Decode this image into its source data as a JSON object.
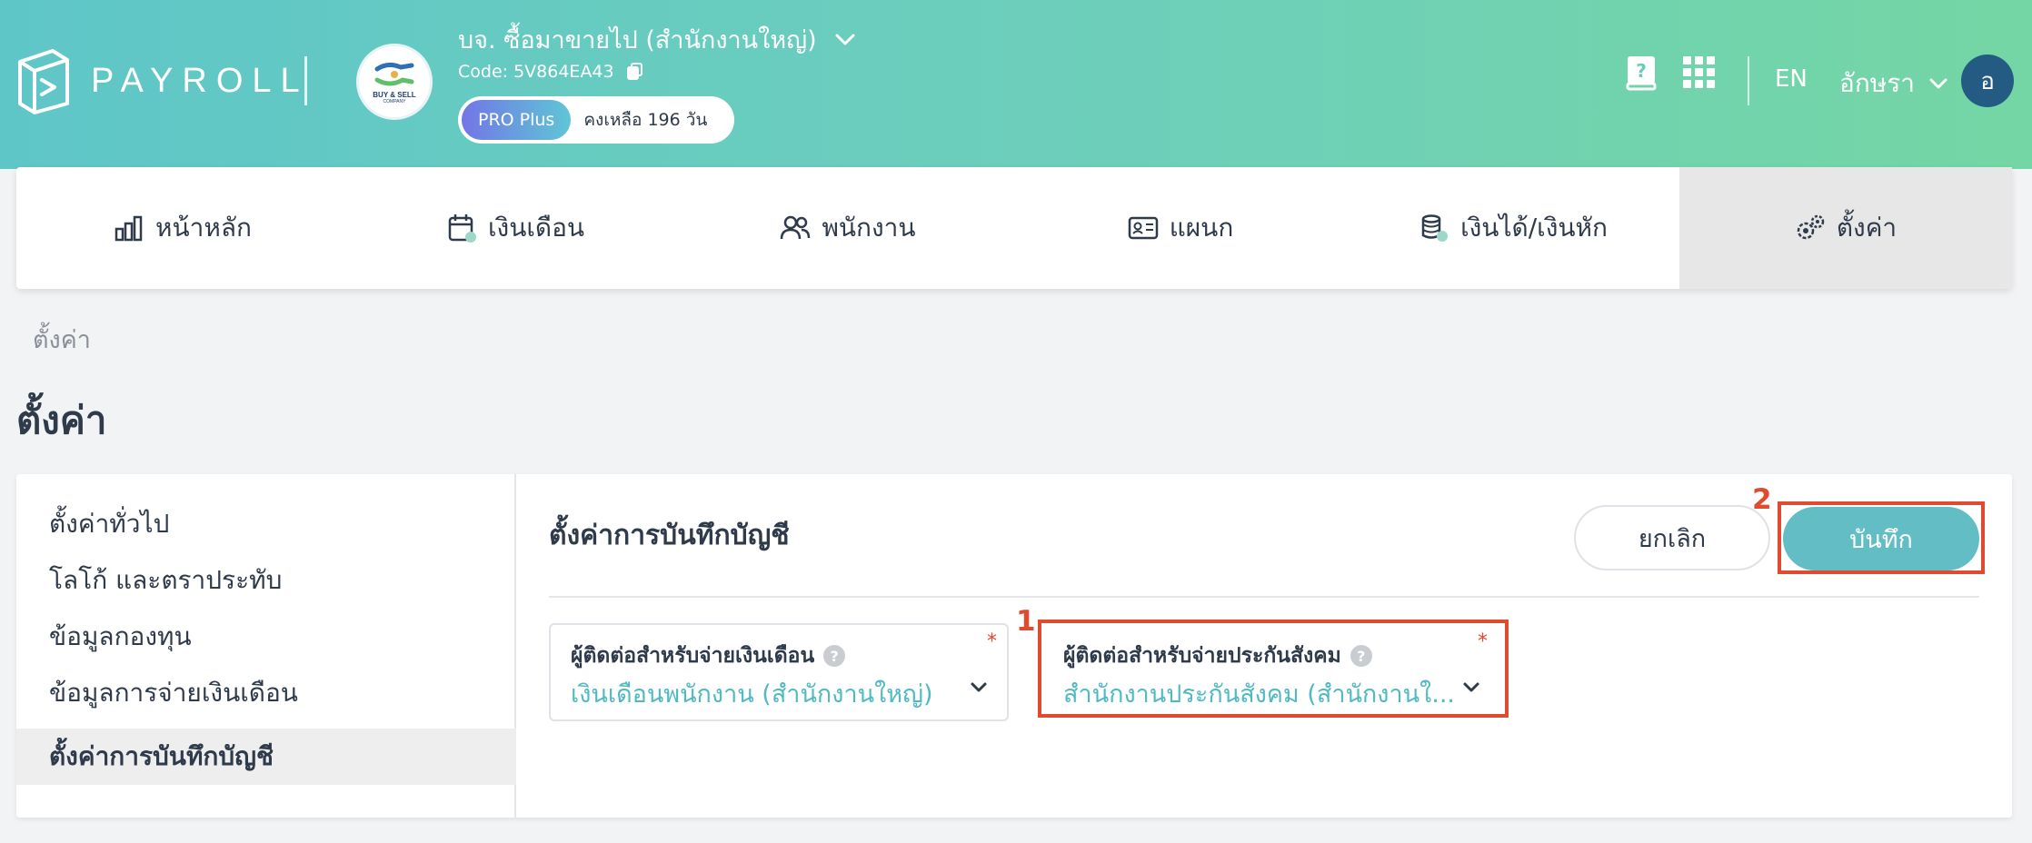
{
  "header": {
    "logo_text": "PAYROLL",
    "company_name": "บจ. ซื้อมาขายไป (สำนักงานใหญ่)",
    "company_logo_caption": "BUY & SELL",
    "company_logo_caption2": "COMPANY",
    "company_code": "Code: 5V864EA43",
    "plan_name": "PRO Plus",
    "plan_remaining": "คงเหลือ 196 วัน",
    "language": "EN",
    "user_name": "อักษรา",
    "user_initial": "อ"
  },
  "nav": {
    "items": [
      {
        "label": "หน้าหลัก",
        "icon": "chart-icon"
      },
      {
        "label": "เงินเดือน",
        "icon": "calendar-icon"
      },
      {
        "label": "พนักงาน",
        "icon": "people-icon"
      },
      {
        "label": "แผนก",
        "icon": "id-card-icon"
      },
      {
        "label": "เงินได้/เงินหัก",
        "icon": "coins-icon"
      },
      {
        "label": "ตั้งค่า",
        "icon": "gears-icon"
      }
    ],
    "active_index": 5
  },
  "breadcrumb": "ตั้งค่า",
  "page_title": "ตั้งค่า",
  "sidebar": {
    "items": [
      {
        "label": "ตั้งค่าทั่วไป"
      },
      {
        "label": "โลโก้ และตราประทับ"
      },
      {
        "label": "ข้อมูลกองทุน"
      },
      {
        "label": "ข้อมูลการจ่ายเงินเดือน"
      },
      {
        "label": "ตั้งค่าการบันทึกบัญชี"
      }
    ],
    "active_index": 4
  },
  "main": {
    "section_title": "ตั้งค่าการบันทึกบัญชี",
    "cancel_label": "ยกเลิก",
    "save_label": "บันทึก",
    "fields": [
      {
        "label": "ผู้ติดต่อสำหรับจ่ายเงินเดือน",
        "value": "เงินเดือนพนักงาน (สำนักงานใหญ่)",
        "required": "*",
        "help": "?"
      },
      {
        "label": "ผู้ติดต่อสำหรับจ่ายประกันสังคม",
        "value": "สำนักงานประกันสังคม (สำนักงานใ...",
        "required": "*",
        "help": "?"
      }
    ]
  },
  "annotations": {
    "step1": "1",
    "step2": "2",
    "highlight_color": "#e04a2f"
  },
  "colors": {
    "accent": "#62bec4",
    "value_text": "#4fbac2",
    "header_gradient_start": "#5fc6c8",
    "header_gradient_end": "#74d6a4",
    "avatar": "#245b82"
  }
}
